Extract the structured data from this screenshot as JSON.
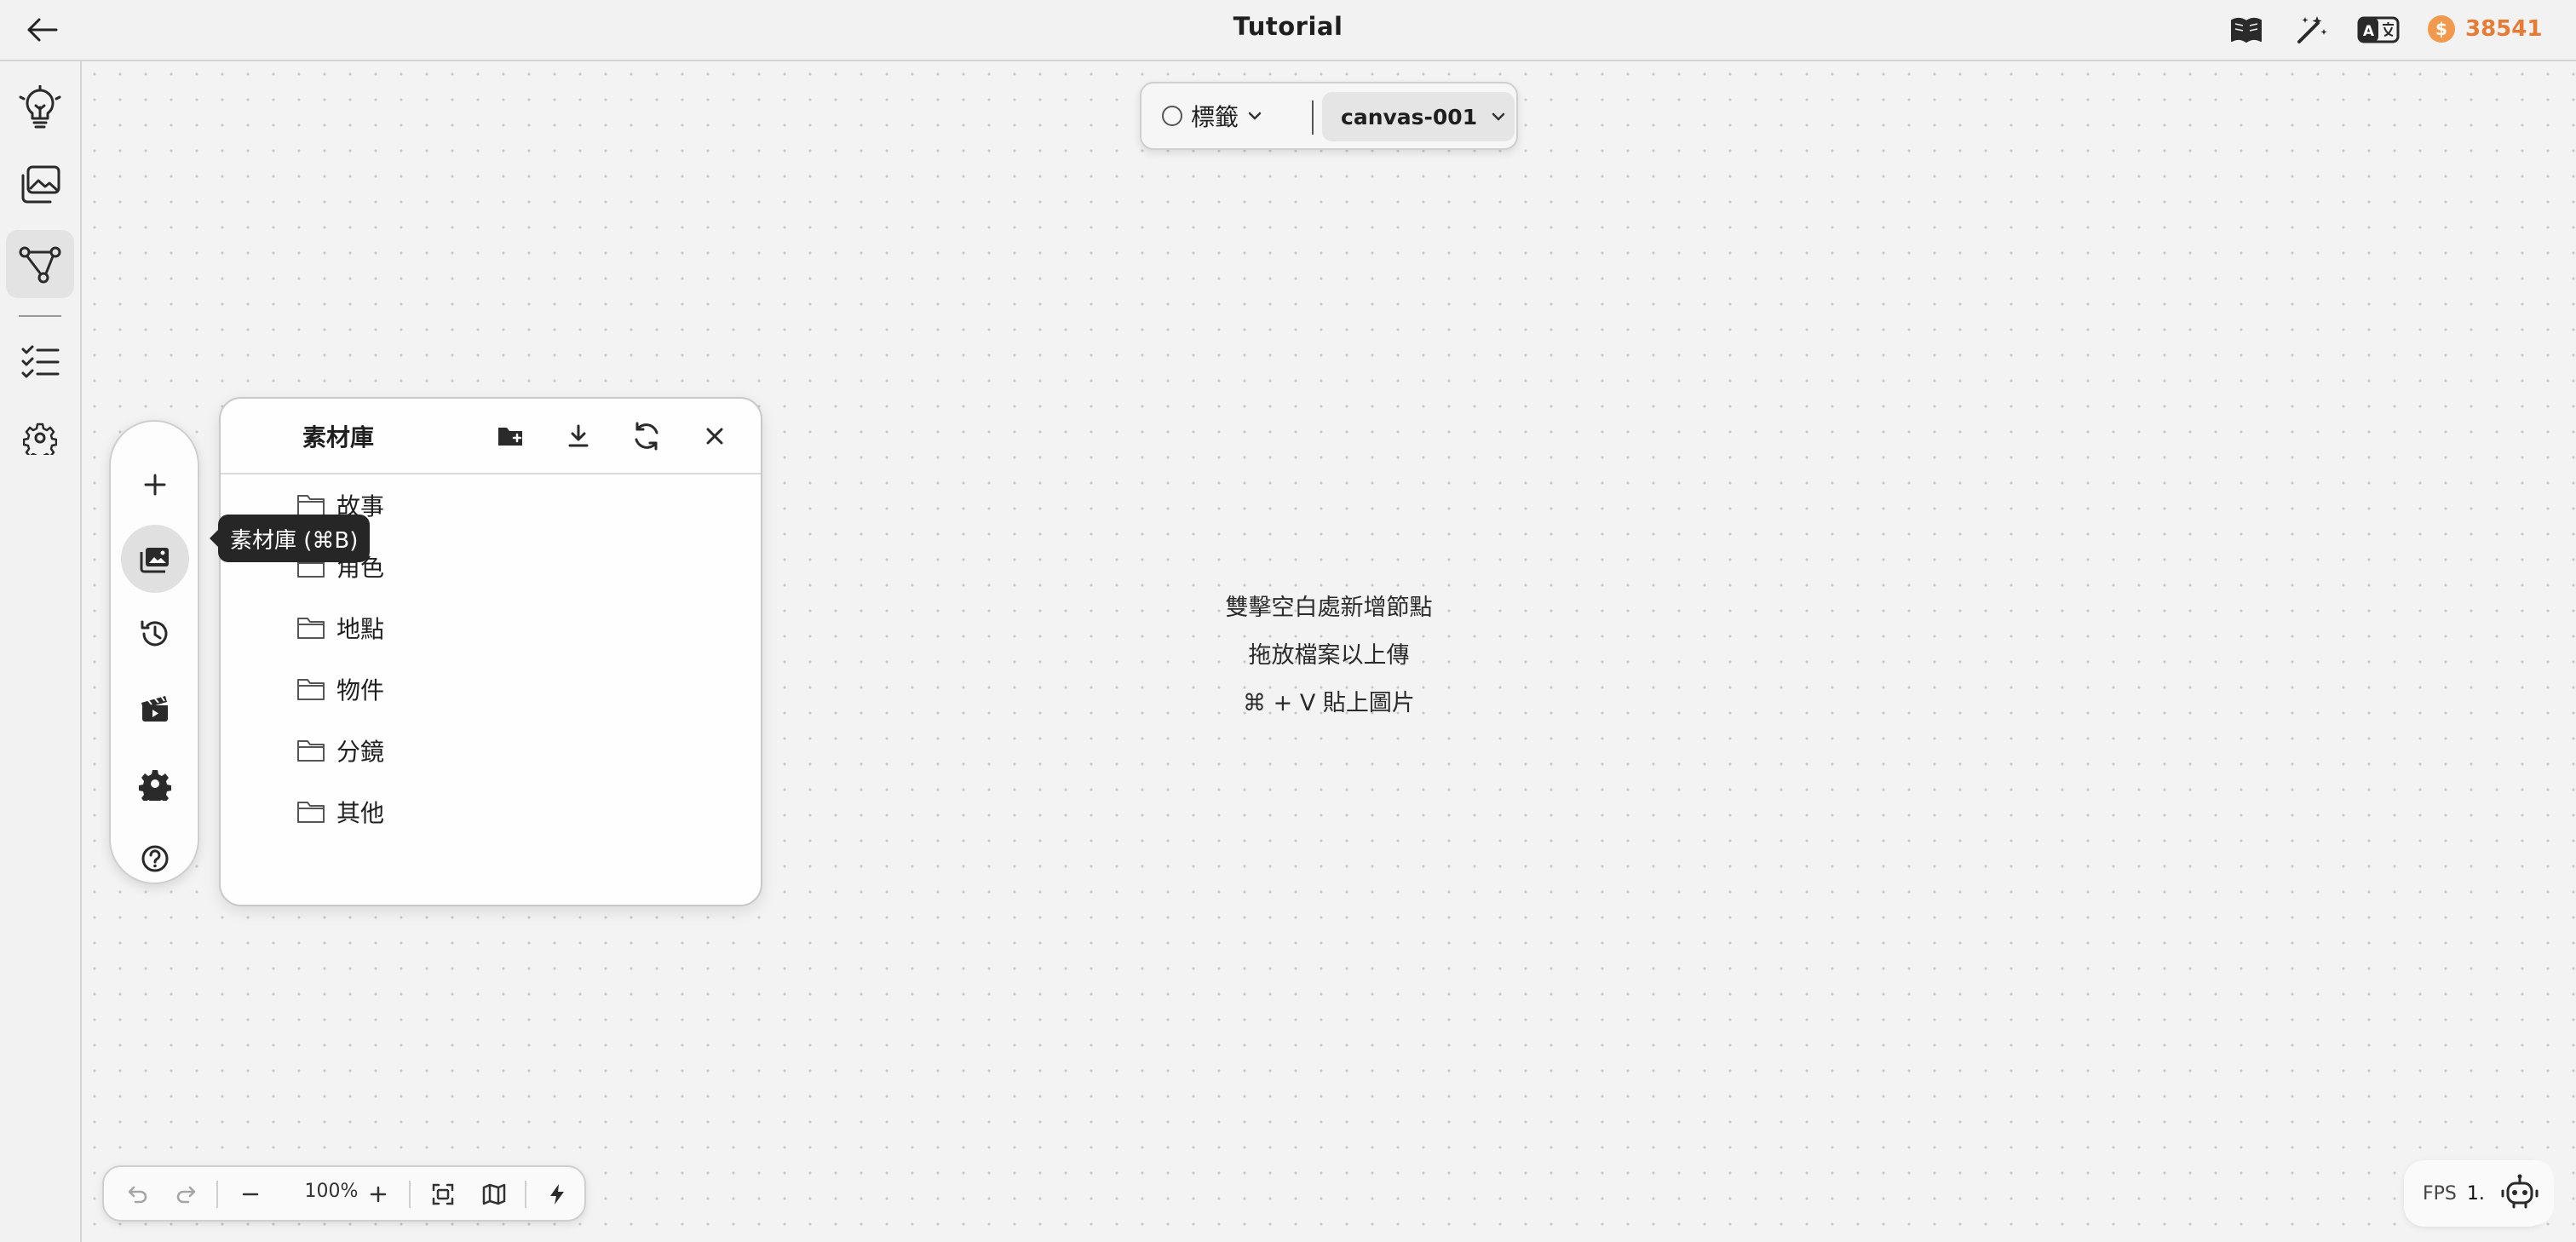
{
  "header": {
    "title": "Tutorial",
    "credits": "38541",
    "coin_symbol": "$",
    "icons": [
      "back-arrow-icon",
      "book-icon",
      "wand-icon",
      "translate-icon",
      "coin-icon"
    ]
  },
  "canvas_switcher": {
    "tag_label": "標籤",
    "canvas_name": "canvas-001"
  },
  "hints": {
    "line1": "雙擊空白處新增節點",
    "line2": "拖放檔案以上傳",
    "line3": "⌘ + V 貼上圖片"
  },
  "tooltip": {
    "text": "素材庫 (⌘B)"
  },
  "library": {
    "title": "素材庫",
    "folders": [
      "故事",
      "角色",
      "地點",
      "物件",
      "分鏡",
      "其他"
    ]
  },
  "zoom": {
    "level": "100%"
  },
  "fps": {
    "label": "FPS",
    "value": "1."
  },
  "colors": {
    "accent": "#e57b35",
    "coin": "#f19a4d",
    "tooltip_bg": "#262626"
  }
}
